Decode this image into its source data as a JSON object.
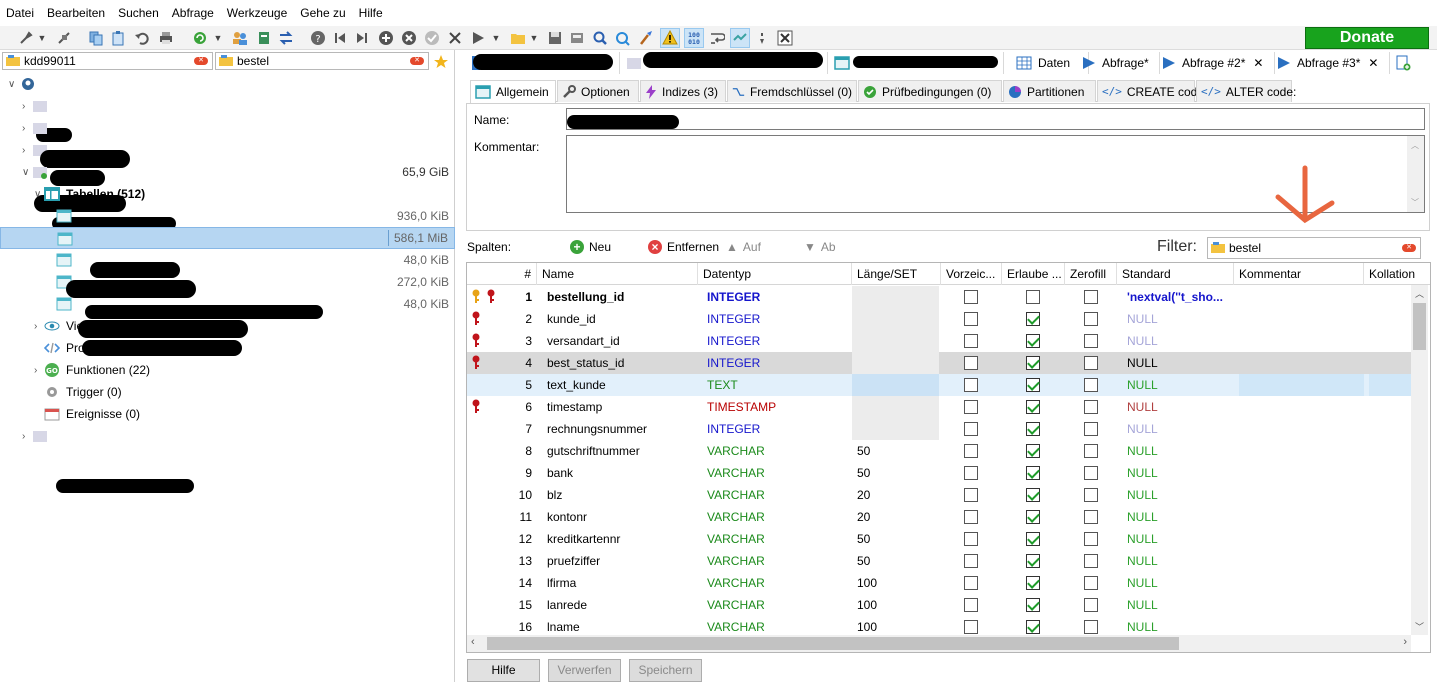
{
  "menu": [
    "Datei",
    "Bearbeiten",
    "Suchen",
    "Abfrage",
    "Werkzeuge",
    "Gehe zu",
    "Hilfe"
  ],
  "donate_label": "Donate",
  "left": {
    "db_filter": "kdd99011",
    "table_filter": "bestel",
    "tree": {
      "db_size": "65,9 GiB",
      "tables_label": "Tabellen (512)",
      "table_sizes": [
        "936,0 KiB",
        "586,1 MiB",
        "48,0 KiB",
        "272,0 KiB",
        "48,0 KiB"
      ],
      "views": "Views (137)",
      "procedures": "Prozeduren (0)",
      "functions": "Funktionen (22)",
      "triggers": "Trigger (0)",
      "events": "Ereignisse (0)"
    }
  },
  "tabs": {
    "data": "Daten",
    "queries": [
      "Abfrage*",
      "Abfrage #2*",
      "Abfrage #3*"
    ]
  },
  "subtabs": [
    "Allgemein",
    "Optionen",
    "Indizes (3)",
    "Fremdschlüssel (0)",
    "Prüfbedingungen (0)",
    "Partitionen",
    "CREATE code",
    "ALTER code:"
  ],
  "general": {
    "name_label": "Name:",
    "comment_label": "Kommentar:"
  },
  "columns_toolbar": {
    "label": "Spalten:",
    "new": "Neu",
    "remove": "Entfernen",
    "up": "Auf",
    "down": "Ab",
    "filter_label": "Filter:",
    "filter_value": "bestel"
  },
  "grid": {
    "headers": [
      "#",
      "Name",
      "Datentyp",
      "Länge/SET",
      "Vorzeic...",
      "Erlaube ...",
      "Zerofill",
      "Standard",
      "Kommentar",
      "Kollation"
    ],
    "rows": [
      {
        "n": "1",
        "name": "bestellung_id",
        "type": "INTEGER",
        "len": "",
        "unsigned": false,
        "allow_null": false,
        "zerofill": false,
        "default": "'nextval(''t_sho...",
        "keys": "pk-fk"
      },
      {
        "n": "2",
        "name": "kunde_id",
        "type": "INTEGER",
        "len": "",
        "unsigned": false,
        "allow_null": true,
        "zerofill": false,
        "default": "NULL",
        "keys": "fk"
      },
      {
        "n": "3",
        "name": "versandart_id",
        "type": "INTEGER",
        "len": "",
        "unsigned": false,
        "allow_null": true,
        "zerofill": false,
        "default": "NULL",
        "keys": "fk"
      },
      {
        "n": "4",
        "name": "best_status_id",
        "type": "INTEGER",
        "len": "",
        "unsigned": false,
        "allow_null": true,
        "zerofill": false,
        "default": "NULL",
        "keys": "fk"
      },
      {
        "n": "5",
        "name": "text_kunde",
        "type": "TEXT",
        "len": "",
        "unsigned": false,
        "allow_null": true,
        "zerofill": false,
        "default": "NULL",
        "keys": ""
      },
      {
        "n": "6",
        "name": "timestamp",
        "type": "TIMESTAMP",
        "len": "",
        "unsigned": false,
        "allow_null": true,
        "zerofill": false,
        "default": "NULL",
        "keys": "fk"
      },
      {
        "n": "7",
        "name": "rechnungsnummer",
        "type": "INTEGER",
        "len": "",
        "unsigned": false,
        "allow_null": true,
        "zerofill": false,
        "default": "NULL",
        "keys": ""
      },
      {
        "n": "8",
        "name": "gutschriftnummer",
        "type": "VARCHAR",
        "len": "50",
        "unsigned": false,
        "allow_null": true,
        "zerofill": false,
        "default": "NULL",
        "keys": ""
      },
      {
        "n": "9",
        "name": "bank",
        "type": "VARCHAR",
        "len": "50",
        "unsigned": false,
        "allow_null": true,
        "zerofill": false,
        "default": "NULL",
        "keys": ""
      },
      {
        "n": "10",
        "name": "blz",
        "type": "VARCHAR",
        "len": "20",
        "unsigned": false,
        "allow_null": true,
        "zerofill": false,
        "default": "NULL",
        "keys": ""
      },
      {
        "n": "11",
        "name": "kontonr",
        "type": "VARCHAR",
        "len": "20",
        "unsigned": false,
        "allow_null": true,
        "zerofill": false,
        "default": "NULL",
        "keys": ""
      },
      {
        "n": "12",
        "name": "kreditkartennr",
        "type": "VARCHAR",
        "len": "50",
        "unsigned": false,
        "allow_null": true,
        "zerofill": false,
        "default": "NULL",
        "keys": ""
      },
      {
        "n": "13",
        "name": "pruefziffer",
        "type": "VARCHAR",
        "len": "50",
        "unsigned": false,
        "allow_null": true,
        "zerofill": false,
        "default": "NULL",
        "keys": ""
      },
      {
        "n": "14",
        "name": "lfirma",
        "type": "VARCHAR",
        "len": "100",
        "unsigned": false,
        "allow_null": true,
        "zerofill": false,
        "default": "NULL",
        "keys": ""
      },
      {
        "n": "15",
        "name": "lanrede",
        "type": "VARCHAR",
        "len": "100",
        "unsigned": false,
        "allow_null": true,
        "zerofill": false,
        "default": "NULL",
        "keys": ""
      },
      {
        "n": "16",
        "name": "lname",
        "type": "VARCHAR",
        "len": "100",
        "unsigned": false,
        "allow_null": true,
        "zerofill": false,
        "default": "NULL",
        "keys": ""
      }
    ]
  },
  "buttons": {
    "help": "Hilfe",
    "discard": "Verwerfen",
    "save": "Speichern"
  },
  "colors": {
    "donate": "#18a31d",
    "integer": "#1515cc",
    "varchar": "#1b8a1b",
    "timestamp": "#b80000",
    "selection": "#b6d6f2",
    "annotation_arrow": "#e8663f"
  }
}
